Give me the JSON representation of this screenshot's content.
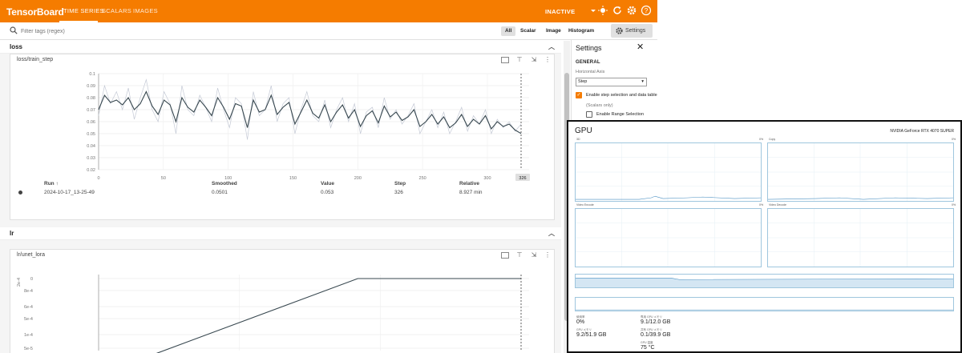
{
  "app": {
    "brand": "TensorBoard",
    "tabs": [
      "TIME SERIES",
      "SCALARS",
      "IMAGES"
    ],
    "status": "INACTIVE"
  },
  "filter": {
    "placeholder": "Filter tags (regex)",
    "types": [
      "All",
      "Scalar",
      "Image",
      "Histogram"
    ],
    "settings_label": "Settings"
  },
  "groups": [
    {
      "name": "loss",
      "card": {
        "title": "loss/train_step",
        "table": {
          "headers": [
            "Run ↑",
            "Smoothed",
            "Value",
            "Step",
            "Relative"
          ],
          "row": [
            "2024-10-17_13-25-49",
            "0.0501",
            "0.053",
            "326",
            "8.927 min"
          ]
        },
        "step_badge": "326"
      }
    },
    {
      "name": "lr",
      "card": {
        "title": "lr/unet_lora"
      }
    }
  ],
  "settings_panel": {
    "title": "Settings",
    "section": "GENERAL",
    "horizontal_axis_label": "Horizontal Axis",
    "horizontal_axis_value": "Step",
    "enable_step_selection": "Enable step selection and data table",
    "scalars_only": "(Scalars only)",
    "enable_range": "Enable Range Selection"
  },
  "chart_data": [
    {
      "type": "line",
      "title": "loss/train_step",
      "xlim": [
        0,
        326
      ],
      "ylim": [
        0.02,
        0.1
      ],
      "x_ticks": [
        "0",
        "50",
        "100",
        "150",
        "200",
        "250",
        "300"
      ],
      "y_ticks": [
        "0.1",
        "0.09",
        "0.08",
        "0.07",
        "0.06",
        "0.05",
        "0.04",
        "0.03",
        "0.02"
      ],
      "series": [
        {
          "values": [
            0.065,
            0.09,
            0.075,
            0.085,
            0.07,
            0.088,
            0.062,
            0.08,
            0.095,
            0.07,
            0.06,
            0.085,
            0.075,
            0.05,
            0.09,
            0.07,
            0.065,
            0.082,
            0.072,
            0.06,
            0.088,
            0.07,
            0.055,
            0.08,
            0.075,
            0.045,
            0.085,
            0.065,
            0.07,
            0.09,
            0.06,
            0.075,
            0.08,
            0.05,
            0.07,
            0.085,
            0.065,
            0.06,
            0.078,
            0.055,
            0.07,
            0.08,
            0.06,
            0.075,
            0.05,
            0.068,
            0.072,
            0.055,
            0.08,
            0.062,
            0.07,
            0.058,
            0.065,
            0.075,
            0.05,
            0.06,
            0.07,
            0.055,
            0.068,
            0.05,
            0.06,
            0.072,
            0.052,
            0.065,
            0.058,
            0.07,
            0.05,
            0.062,
            0.055,
            0.06,
            0.052,
            0.058
          ]
        },
        {
          "values": [
            0.07,
            0.082,
            0.076,
            0.078,
            0.074,
            0.08,
            0.07,
            0.075,
            0.085,
            0.073,
            0.066,
            0.078,
            0.074,
            0.06,
            0.08,
            0.072,
            0.068,
            0.078,
            0.072,
            0.065,
            0.08,
            0.072,
            0.062,
            0.075,
            0.073,
            0.055,
            0.078,
            0.068,
            0.07,
            0.082,
            0.066,
            0.072,
            0.076,
            0.058,
            0.068,
            0.078,
            0.067,
            0.063,
            0.074,
            0.06,
            0.068,
            0.074,
            0.063,
            0.07,
            0.056,
            0.065,
            0.069,
            0.059,
            0.073,
            0.064,
            0.068,
            0.061,
            0.064,
            0.07,
            0.056,
            0.06,
            0.066,
            0.058,
            0.064,
            0.055,
            0.059,
            0.066,
            0.056,
            0.062,
            0.058,
            0.065,
            0.054,
            0.06,
            0.056,
            0.058,
            0.053,
            0.0501
          ]
        }
      ]
    },
    {
      "type": "line",
      "title": "lr/unet_lora",
      "x": [
        0,
        200,
        326
      ],
      "y_ticks": [
        "0",
        "8e-4",
        "6e-4",
        "5e-4",
        "1e-4",
        "5e-5"
      ],
      "y_unit": "2e-4",
      "series": [
        {
          "values": [
            0,
            1,
            1
          ]
        }
      ]
    }
  ],
  "gpu": {
    "title": "GPU",
    "model": "NVIDIA GeForce RTX 4070 SUPER",
    "panels": [
      {
        "label": "3D",
        "pct": "0%"
      },
      {
        "label": "Copy",
        "pct": "0%"
      },
      {
        "label": "Video Encode",
        "pct": "0%"
      },
      {
        "label": "Video Decode",
        "pct": "0%"
      }
    ],
    "stats": [
      {
        "label": "使用率",
        "value": "0%"
      },
      {
        "label": "専用 GPU メモリ",
        "value": "9.1/12.0 GB"
      },
      {
        "label": "GPU メモリ",
        "value": "9.2/51.9 GB"
      },
      {
        "label": "共有 GPU メモリ",
        "value": "0.1/39.9 GB"
      },
      {
        "label": "GPU 温度",
        "value": "75 °C"
      }
    ]
  }
}
